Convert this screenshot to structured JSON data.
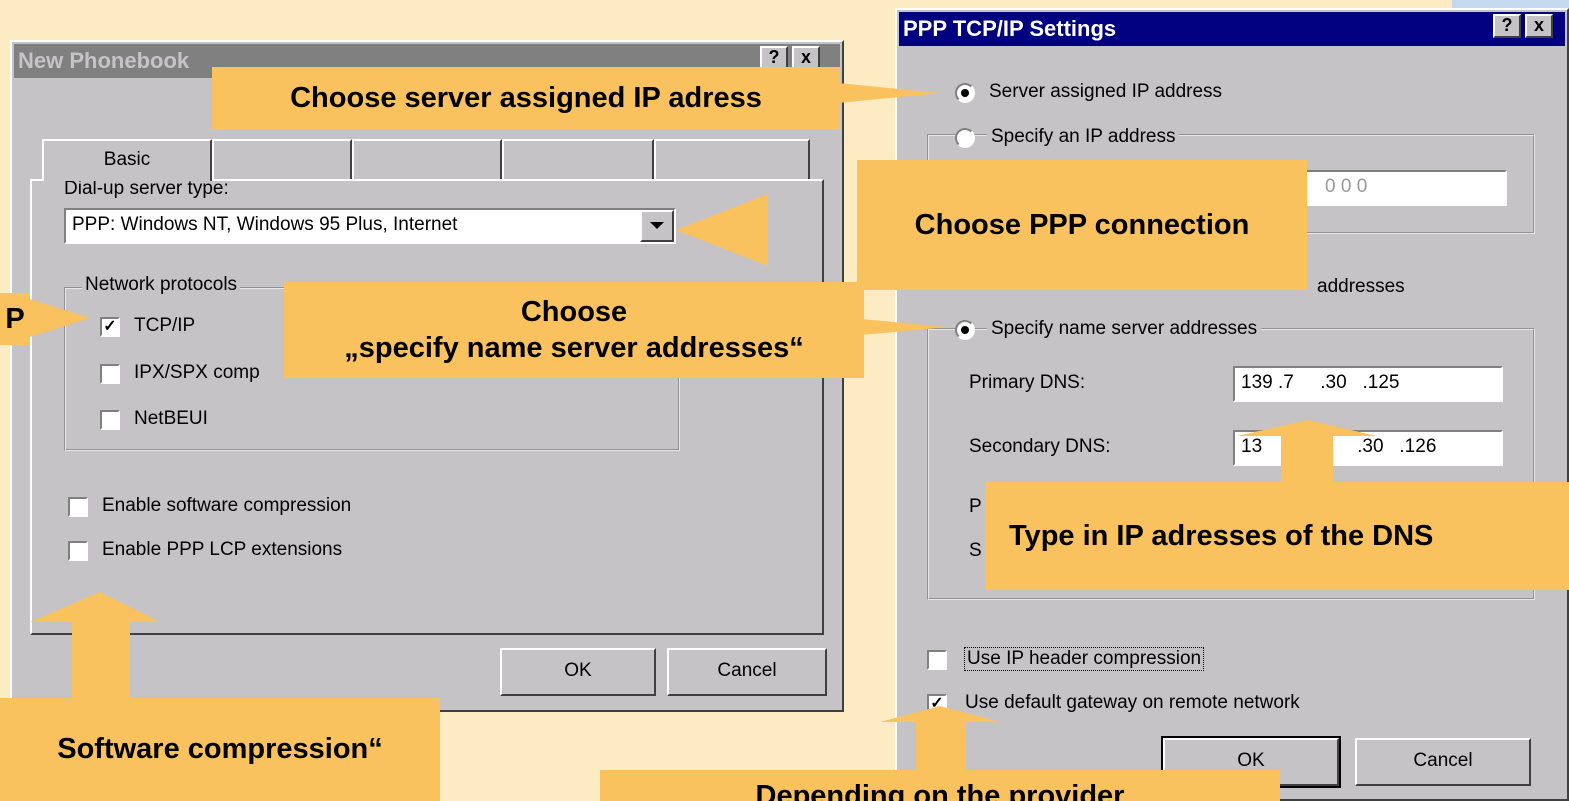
{
  "left_dialog": {
    "title": "New Phonebook",
    "help_glyph": "?",
    "close_glyph": "x",
    "tabs": [
      "Basic"
    ],
    "server_type_label": "Dial-up server type:",
    "server_type_value": "PPP: Windows NT, Windows 95 Plus, Internet",
    "protocols_label": "Network protocols",
    "protocols": [
      {
        "label": "TCP/IP",
        "checked": true
      },
      {
        "label": "IPX/SPX comp",
        "checked": false
      },
      {
        "label": "NetBEUI",
        "checked": false
      }
    ],
    "options": [
      {
        "label": "Enable software compression",
        "checked": false
      },
      {
        "label": "Enable PPP LCP extensions",
        "checked": false
      }
    ],
    "ok_label": "OK",
    "cancel_label": "Cancel"
  },
  "right_dialog": {
    "title": "PPP TCP/IP Settings",
    "help_glyph": "?",
    "close_glyph": "x",
    "server_ip_label": "Server assigned IP address",
    "specify_ip_label": "Specify an IP address",
    "ip_placeholder_dots": "0     0     0",
    "server_names_label": "addresses",
    "specify_names_label": "Specify name server addresses",
    "primary_dns_label": "Primary DNS:",
    "primary_dns_value": "139 .7     .30   .125",
    "secondary_dns_label": "Secondary DNS:",
    "secondary_dns_value": "13                  .30   .126",
    "partial_label_p": "P",
    "partial_label_s": "S",
    "ip_header_label": "Use IP header compression",
    "default_gateway_label": "Use default gateway on remote network",
    "ok_label": "OK",
    "cancel_label": "Cancel"
  },
  "callouts": {
    "server_ip": "Choose server assigned IP adress",
    "ppp": "Choose PPP connection",
    "specify_ns_1": "Choose",
    "specify_ns_2": "„specify name server addresses“",
    "dns": "Type in IP adresses of the DNS",
    "tcp_fragment": "P",
    "software": "Software compression“",
    "provider": "Depending on the provider"
  },
  "colors": {
    "background": "#fcebc3",
    "callout": "#f9c25e",
    "active_title": "#000080",
    "inactive_title": "#808080"
  }
}
